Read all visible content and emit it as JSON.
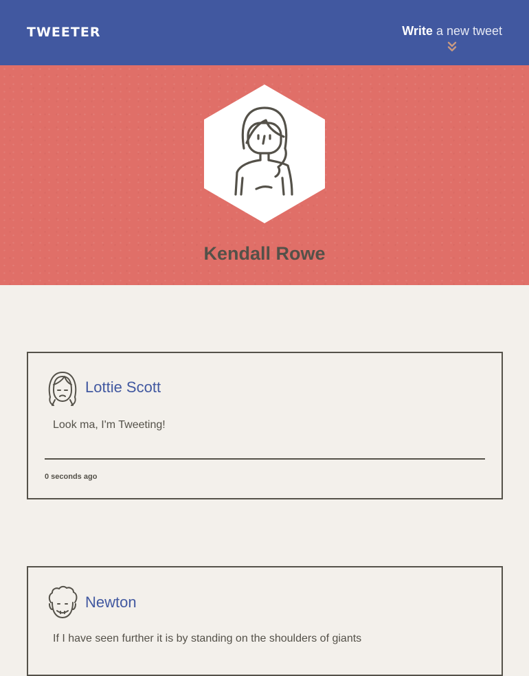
{
  "nav": {
    "brand": "TWEETER",
    "compose_strong": "Write",
    "compose_rest": "a new tweet"
  },
  "profile": {
    "name": "Kendall Rowe"
  },
  "tweets": [
    {
      "handle": "Lottie Scott",
      "text": "Look ma, I'm Tweeting!",
      "time": "0 seconds ago"
    },
    {
      "handle": "Newton",
      "text": "If I have seen further it is by standing on the shoulders of giants"
    }
  ],
  "icons": {
    "compose_chevron": "double-chevron-down-icon",
    "profile_avatar": "woman-avatar-icon",
    "tweet_avatar_1": "girl-face-icon",
    "tweet_avatar_2": "curly-hair-face-icon"
  },
  "colors": {
    "nav_bg": "#4158a0",
    "banner_bg": "#e06f68",
    "page_bg": "#f3f0eb",
    "text": "#545149",
    "accent": "#4158a0",
    "chevron": "#c89a82"
  }
}
